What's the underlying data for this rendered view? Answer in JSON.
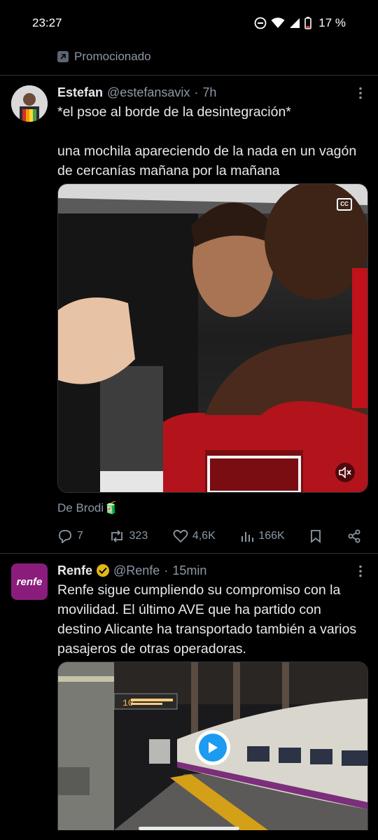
{
  "status_bar": {
    "time": "23:27",
    "battery": "17 %"
  },
  "promo_label": "Promocionado",
  "posts": [
    {
      "name": "Estefan",
      "handle": "@estefansavix",
      "time": "7h",
      "text_line1": "*el psoe al borde de la desintegración*",
      "text_line2": "una mochila apareciendo de la nada en un vagón de cercanías mañana por la mañana",
      "source": "De Brodi🧃",
      "stats": {
        "replies": "7",
        "reposts": "323",
        "likes": "4,6K",
        "views": "166K"
      }
    },
    {
      "name": "Renfe",
      "handle": "@Renfe",
      "time": "15min",
      "avatar_text": "renfe",
      "text": "Renfe sigue cumpliendo su compromiso con la movilidad. El último AVE que ha partido con destino Alicante ha transportado también a varios pasajeros de otras operadoras.",
      "platform_sign": "10"
    }
  ],
  "colors": {
    "background": "#000000",
    "text_primary": "#e7e9ea",
    "text_secondary": "#8b98a5",
    "accent": "#1d9bf0",
    "renfe_purple": "#8a1d7c",
    "verified_gold": "#e2b719"
  }
}
